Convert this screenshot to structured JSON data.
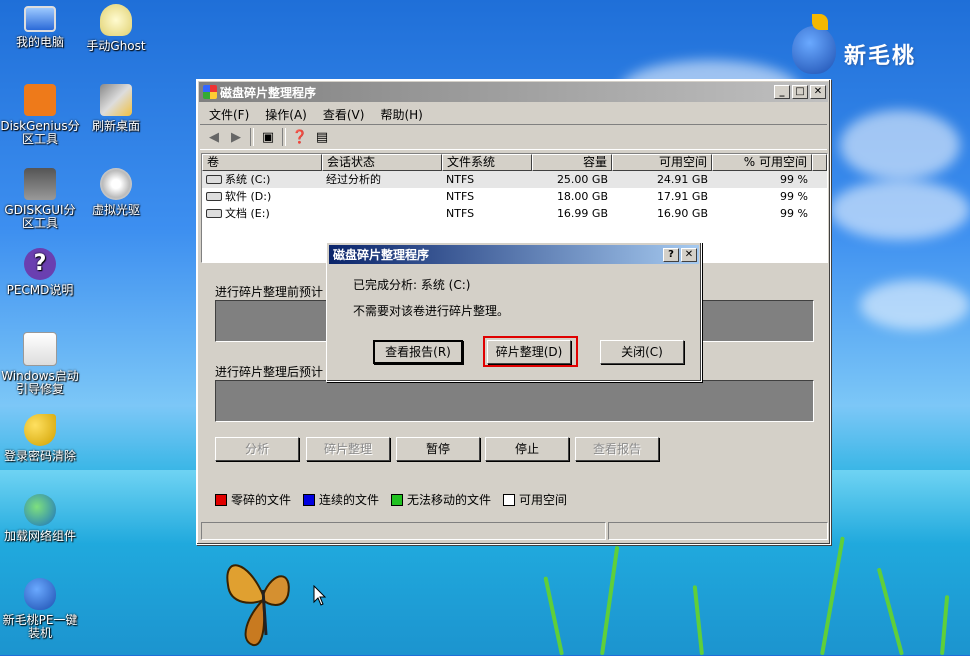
{
  "desktop": {
    "icons": [
      {
        "label": "我的电脑"
      },
      {
        "label": "手动Ghost"
      },
      {
        "label": "DiskGenius分区工具"
      },
      {
        "label": "刷新桌面"
      },
      {
        "label": "GDISKGUI分区工具"
      },
      {
        "label": "虚拟光驱"
      },
      {
        "label": "PECMD说明"
      },
      {
        "label": "Windows启动引导修复"
      },
      {
        "label": "登录密码清除"
      },
      {
        "label": "加载网络组件"
      },
      {
        "label": "新毛桃PE一键装机"
      }
    ],
    "logo_text": "新毛桃"
  },
  "window": {
    "title": "磁盘碎片整理程序",
    "menu": [
      "文件(F)",
      "操作(A)",
      "查看(V)",
      "帮助(H)"
    ],
    "columns": [
      "卷",
      "会话状态",
      "文件系统",
      "容量",
      "可用空间",
      "% 可用空间"
    ],
    "volumes": [
      {
        "name": "系统 (C:)",
        "status": "经过分析的",
        "fs": "NTFS",
        "capacity": "25.00 GB",
        "free": "24.91 GB",
        "pct": "99 %"
      },
      {
        "name": "软件 (D:)",
        "status": "",
        "fs": "NTFS",
        "capacity": "18.00 GB",
        "free": "17.91 GB",
        "pct": "99 %"
      },
      {
        "name": "文档 (E:)",
        "status": "",
        "fs": "NTFS",
        "capacity": "16.99 GB",
        "free": "16.90 GB",
        "pct": "99 %"
      }
    ],
    "before_label": "进行碎片整理前预计",
    "after_label": "进行碎片整理后预计",
    "buttons": {
      "analyze": "分析",
      "defrag": "碎片整理",
      "pause": "暂停",
      "stop": "停止",
      "report": "查看报告"
    },
    "legend": [
      {
        "label": "零碎的文件",
        "color": "#e00000"
      },
      {
        "label": "连续的文件",
        "color": "#0000e0"
      },
      {
        "label": "无法移动的文件",
        "color": "#20c020"
      },
      {
        "label": "可用空间",
        "color": "#ffffff"
      }
    ]
  },
  "dialog": {
    "title": "磁盘碎片整理程序",
    "line1": "已完成分析: 系统 (C:)",
    "line2": "不需要对该卷进行碎片整理。",
    "btn_report": "查看报告(R)",
    "btn_defrag": "碎片整理(D)",
    "btn_close": "关闭(C)",
    "help_glyph": "?",
    "close_glyph": "✕"
  }
}
